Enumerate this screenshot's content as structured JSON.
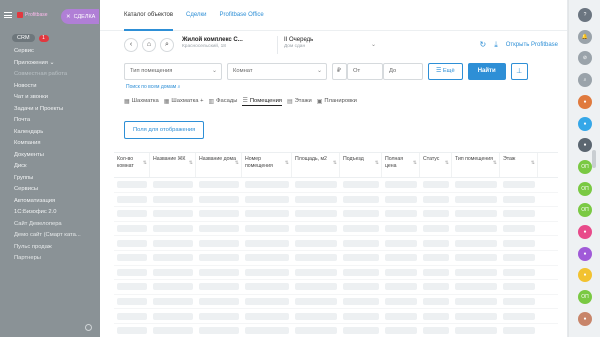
{
  "sidebar": {
    "logo_text": "Profitbase",
    "crm_label": "CRM",
    "crm_badge": "1",
    "items": [
      "Сервис",
      "Приложения",
      "Совместная работа",
      "Новости",
      "Чат и звонки",
      "Задачи и Проекты",
      "Почта",
      "Календарь",
      "Компания",
      "Документы",
      "Диск",
      "Группы",
      "Сервисы",
      "Автоматизация",
      "1С:Бизофис 2.0",
      "Сайт Девелопера",
      "Демо сайт (Смарт ката...",
      "Пульс продаж",
      "Партнеры"
    ]
  },
  "close_button": {
    "label": "СДЕЛКА",
    "icon": "close-icon"
  },
  "tabs": [
    "Каталог объектов",
    "Сделки",
    "Profitbase Office"
  ],
  "object": {
    "title": "Жилой комплекс С...",
    "subtitle": "Красносельский, 18",
    "queue_title": "II Очередь",
    "queue_subtitle": "Дом сдан",
    "open_label": "Открыть Profitbase"
  },
  "filters": {
    "room_type_placeholder": "Тип помещения",
    "rooms_placeholder": "Комнат",
    "currency": "₽",
    "from_placeholder": "От",
    "to_placeholder": "До",
    "all_label": "Ещё",
    "find_label": "Найти"
  },
  "search_all_link": "Поиск по всем домам",
  "view_tabs": [
    {
      "label": "Шахматка",
      "icon": "grid-icon"
    },
    {
      "label": "Шахматка +",
      "icon": "grid-plus-icon"
    },
    {
      "label": "Фасады",
      "icon": "facade-icon"
    },
    {
      "label": "Помещения",
      "icon": "list-icon"
    },
    {
      "label": "Этажи",
      "icon": "floors-icon"
    },
    {
      "label": "Планировки",
      "icon": "layout-icon"
    }
  ],
  "fields_button": "Поля для отображения",
  "table": {
    "columns": [
      "Кол-во комнат",
      "Название ЖК",
      "Название дома",
      "Номер помещения",
      "Площадь, м2",
      "Подъезд",
      "Полная цена",
      "Статус",
      "Тип помещения",
      "Этаж"
    ],
    "row_count": 12
  },
  "rail_icons": [
    {
      "name": "help-icon",
      "label": "?",
      "color": "#6b7580"
    },
    {
      "name": "bell-icon",
      "label": "🔔",
      "color": "#9aa3aa"
    },
    {
      "name": "clock-icon",
      "label": "⊘",
      "color": "#9aa3aa"
    },
    {
      "name": "search-icon",
      "label": "⌕",
      "color": "#9aa3aa"
    },
    {
      "name": "avatar-group-icon",
      "label": "●",
      "color": "#e07a3e"
    },
    {
      "name": "chat-icon",
      "label": "●",
      "color": "#35a7e8"
    },
    {
      "name": "open-channel-icon",
      "label": "●",
      "color": "#5b6670"
    },
    {
      "name": "op-icon-1",
      "label": "ОП",
      "color": "#7ac943"
    },
    {
      "name": "op-icon-2",
      "label": "ОП",
      "color": "#7ac943"
    },
    {
      "name": "op-icon-3",
      "label": "ОП",
      "color": "#7ac943"
    },
    {
      "name": "pink-icon",
      "label": "●",
      "color": "#e84a8a"
    },
    {
      "name": "purple-icon",
      "label": "●",
      "color": "#a05ad8"
    },
    {
      "name": "yellow-icon",
      "label": "●",
      "color": "#f2c230"
    },
    {
      "name": "op-icon-4",
      "label": "ОП",
      "color": "#7ac943"
    },
    {
      "name": "user-avatar",
      "label": "●",
      "color": "#c8856a"
    }
  ]
}
